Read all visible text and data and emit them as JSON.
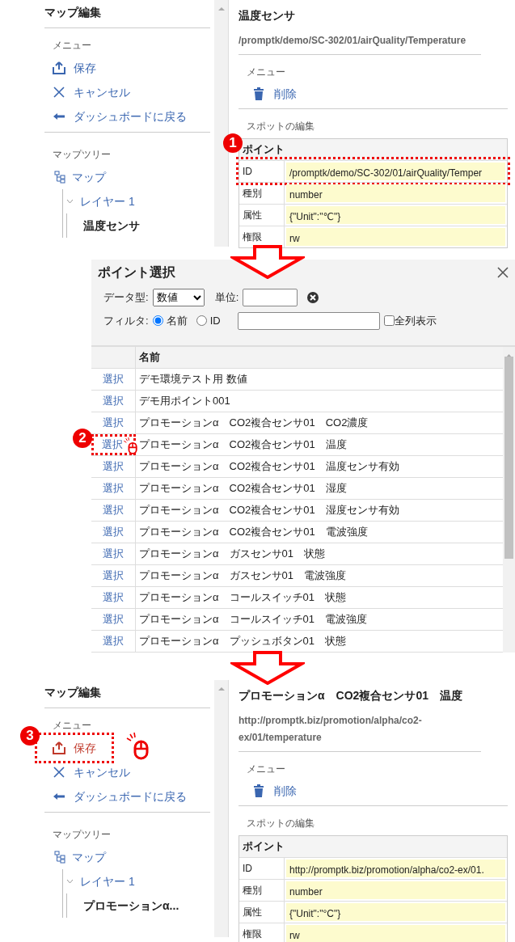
{
  "panels": [
    {
      "kind": "editor",
      "sidebar": {
        "title": "マップ編集",
        "menu_heading": "メニュー",
        "menu": [
          {
            "label": "保存",
            "highlighted": false
          },
          {
            "label": "キャンセル",
            "highlighted": false
          },
          {
            "label": "ダッシュボードに戻る",
            "highlighted": false
          }
        ],
        "tree_heading": "マップツリー",
        "tree": [
          {
            "label": "マップ",
            "children": [
              {
                "label": "レイヤー 1",
                "expanded": true,
                "children": [
                  {
                    "label": "温度センサ"
                  }
                ]
              }
            ]
          }
        ]
      },
      "detail": {
        "title": "温度センサ",
        "path": "/promptk/demo/SC-302/01/airQuality/Temperature",
        "menu_heading": "メニュー",
        "menu": [
          {
            "label": "削除"
          }
        ],
        "section": "スポットの編集",
        "table_title": "ポイント",
        "rows": [
          {
            "label": "ID",
            "value": "/promptk/demo/SC-302/01/airQuality/Temper",
            "highlighted": true,
            "step": "1"
          },
          {
            "label": "種別",
            "value": "number",
            "highlighted": false
          },
          {
            "label": "属性",
            "value": "{\"Unit\":\"℃\"}",
            "highlighted": false
          },
          {
            "label": "権限",
            "value": "rw",
            "highlighted": false
          }
        ]
      }
    },
    {
      "kind": "dialog",
      "title": "ポイント選択",
      "datatype_label": "データ型:",
      "datatype_value": "数値",
      "unit_label": "単位:",
      "filter_label": "フィルタ:",
      "radios": [
        {
          "label": "名前",
          "selected": true
        },
        {
          "label": "ID",
          "selected": false
        }
      ],
      "all_columns": {
        "label": "全列表示",
        "checked": false
      },
      "column_header": "名前",
      "rows": [
        {
          "action": "選択",
          "name": "デモ環境テスト用 数値",
          "highlighted": false
        },
        {
          "action": "選択",
          "name": "デモ用ポイント001",
          "highlighted": false
        },
        {
          "action": "選択",
          "name": "プロモーションα　CO2複合センサ01　CO2濃度",
          "highlighted": false
        },
        {
          "action": "選択",
          "name": "プロモーションα　CO2複合センサ01　温度",
          "highlighted": true,
          "step": "2"
        },
        {
          "action": "選択",
          "name": "プロモーションα　CO2複合センサ01　温度センサ有効",
          "highlighted": false
        },
        {
          "action": "選択",
          "name": "プロモーションα　CO2複合センサ01　湿度",
          "highlighted": false
        },
        {
          "action": "選択",
          "name": "プロモーションα　CO2複合センサ01　湿度センサ有効",
          "highlighted": false
        },
        {
          "action": "選択",
          "name": "プロモーションα　CO2複合センサ01　電波強度",
          "highlighted": false
        },
        {
          "action": "選択",
          "name": "プロモーションα　ガスセンサ01　状態",
          "highlighted": false
        },
        {
          "action": "選択",
          "name": "プロモーションα　ガスセンサ01　電波強度",
          "highlighted": false
        },
        {
          "action": "選択",
          "name": "プロモーションα　コールスイッチ01　状態",
          "highlighted": false
        },
        {
          "action": "選択",
          "name": "プロモーションα　コールスイッチ01　電波強度",
          "highlighted": false
        },
        {
          "action": "選択",
          "name": "プロモーションα　プッシュボタン01　状態",
          "highlighted": false
        }
      ]
    },
    {
      "kind": "editor",
      "sidebar": {
        "title": "マップ編集",
        "menu_heading": "メニュー",
        "menu": [
          {
            "label": "保存",
            "highlighted": true,
            "step": "3"
          },
          {
            "label": "キャンセル",
            "highlighted": false
          },
          {
            "label": "ダッシュボードに戻る",
            "highlighted": false
          }
        ],
        "tree_heading": "マップツリー",
        "tree": [
          {
            "label": "マップ",
            "children": [
              {
                "label": "レイヤー 1",
                "expanded": true,
                "children": [
                  {
                    "label": "プロモーションα..."
                  }
                ]
              }
            ]
          }
        ]
      },
      "detail": {
        "title": "プロモーションα　CO2複合センサ01　温度",
        "path": "http://promptk.biz/promotion/alpha/co2-ex/01/temperature",
        "menu_heading": "メニュー",
        "menu": [
          {
            "label": "削除"
          }
        ],
        "section": "スポットの編集",
        "table_title": "ポイント",
        "rows": [
          {
            "label": "ID",
            "value": "http://promptk.biz/promotion/alpha/co2-ex/01.",
            "highlighted": false
          },
          {
            "label": "種別",
            "value": "number",
            "highlighted": false
          },
          {
            "label": "属性",
            "value": "{\"Unit\":\"°C\"}",
            "highlighted": false
          },
          {
            "label": "権限",
            "value": "rw",
            "highlighted": false
          }
        ]
      }
    }
  ]
}
